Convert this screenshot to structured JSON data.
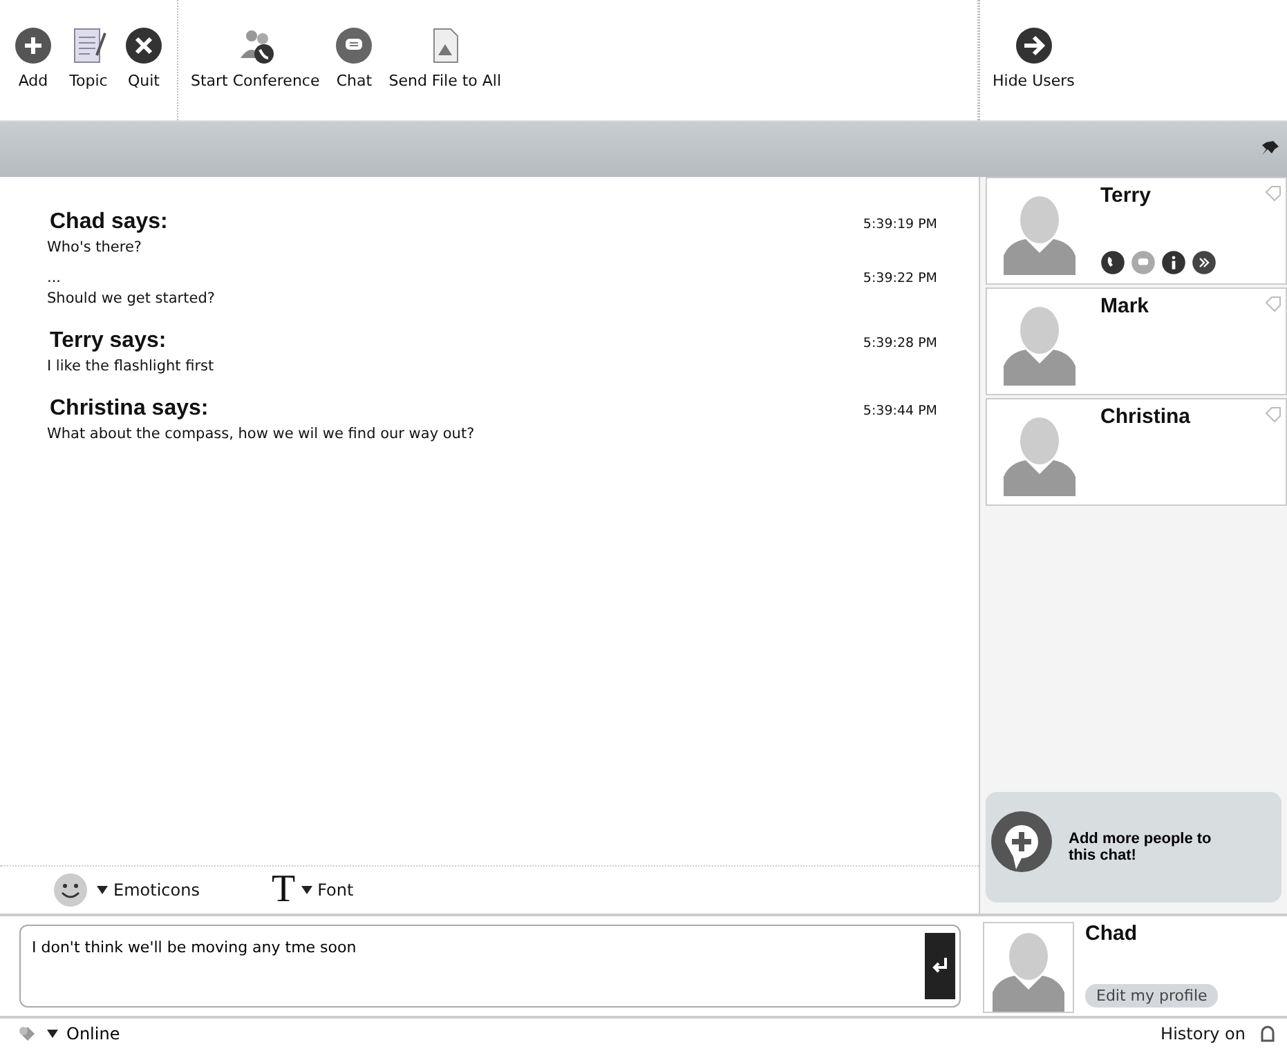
{
  "toolbar": {
    "groups": [
      [
        {
          "label": "Add"
        },
        {
          "label": "Topic"
        },
        {
          "label": "Quit"
        }
      ],
      [
        {
          "label": "Start Conference"
        },
        {
          "label": "Chat"
        },
        {
          "label": "Send File to All"
        }
      ]
    ],
    "right": {
      "label": "Hide Users"
    }
  },
  "messages": [
    {
      "kind": "sender",
      "text": "Chad says:",
      "time": "5:39:19 PM"
    },
    {
      "kind": "line",
      "text": "Who's there?"
    },
    {
      "kind": "note",
      "text": "...",
      "time": "5:39:22 PM"
    },
    {
      "kind": "line",
      "text": "Should we get started?"
    },
    {
      "kind": "sender",
      "text": "Terry says:",
      "time": "5:39:28 PM"
    },
    {
      "kind": "line",
      "text": "I like the flashlight first"
    },
    {
      "kind": "sender",
      "text": "Christina says:",
      "time": "5:39:44 PM"
    },
    {
      "kind": "line",
      "text": "What about the compass, how we wil we find our way out?"
    }
  ],
  "users": [
    {
      "name": "Terry",
      "actions_shown": true
    },
    {
      "name": "Mark",
      "actions_shown": false
    },
    {
      "name": "Christina",
      "actions_shown": false
    }
  ],
  "add_people": {
    "label": "Add more people to this chat!"
  },
  "format_bar": [
    {
      "label": "Emoticons"
    },
    {
      "label": "Font",
      "glyph": "T"
    }
  ],
  "input": {
    "value": "I don't think we'll be moving any tme soon"
  },
  "me": {
    "name": "Chad",
    "edit_label": "Edit my profile"
  },
  "status_bar": {
    "status": "Online",
    "history": "History on"
  }
}
